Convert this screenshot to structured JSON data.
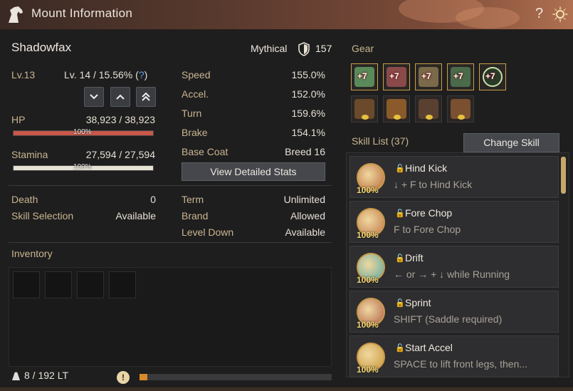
{
  "window": {
    "title": "Mount Information",
    "help": "?"
  },
  "mount": {
    "name": "Shadowfax",
    "rarity": "Mythical",
    "rarity_value": "157",
    "level_label": "Lv.13",
    "next_level": "Lv. 14 / 15.56% (",
    "next_level_help": "?",
    "next_level_close": ")"
  },
  "vitals": {
    "hp_label": "HP",
    "hp_value": "38,923 / 38,923",
    "hp_pct_text": "100%",
    "hp_fill": 1.0,
    "hp_color": "#c8584a",
    "stamina_label": "Stamina",
    "stamina_value": "27,594 / 27,594",
    "stamina_pct_text": "100%",
    "stamina_fill": 1.0,
    "stamina_color": "#e6e2d4"
  },
  "stats": [
    {
      "label": "Speed",
      "value": "155.0%"
    },
    {
      "label": "Accel.",
      "value": "152.0%"
    },
    {
      "label": "Turn",
      "value": "159.6%"
    },
    {
      "label": "Brake",
      "value": "154.1%"
    },
    {
      "label": "Base Coat",
      "value": "Breed 16"
    }
  ],
  "detail_button": "View Detailed Stats",
  "info_left": [
    {
      "label": "Death",
      "value": "0"
    },
    {
      "label": "Skill Selection",
      "value": "Available"
    }
  ],
  "info_right": [
    {
      "label": "Term",
      "value": "Unlimited"
    },
    {
      "label": "Brand",
      "value": "Allowed"
    },
    {
      "label": "Level Down",
      "value": "Available"
    }
  ],
  "inventory": {
    "title": "Inventory",
    "weight": "8 / 192 LT",
    "weight_fill": 0.04,
    "warn": "!"
  },
  "gear": {
    "title": "Gear",
    "enhanced": [
      "+7",
      "+7",
      "+7",
      "+7",
      "+7"
    ],
    "colors": [
      "#5a8a5a",
      "#8a4a4a",
      "#7a6a4a",
      "#4a6a4a",
      "#2a3a2a"
    ],
    "costume_colors": [
      "#6a4a2a",
      "#8a5a2a",
      "#5a4030",
      "#7a5030"
    ]
  },
  "skills": {
    "title": "Skill List (37)",
    "change_button": "Change Skill",
    "items": [
      {
        "name": "Hind Kick",
        "desc": "↓ + F to Hind Kick",
        "pct": "100%",
        "icon_color": "#b86a3a"
      },
      {
        "name": "Fore Chop",
        "desc": "F to Fore Chop",
        "pct": "100%",
        "icon_color": "#c07a4a"
      },
      {
        "name": "Drift",
        "desc": "← or → + ↓ while Running",
        "pct": "100%",
        "icon_color": "#5aa8a0"
      },
      {
        "name": "Sprint",
        "desc": "SHIFT (Saddle required)",
        "pct": "100%",
        "icon_color": "#b0604a"
      },
      {
        "name": "Start Accel",
        "desc": "SPACE to lift front legs, then...",
        "pct": "100%",
        "icon_color": "#c8983a"
      }
    ]
  }
}
